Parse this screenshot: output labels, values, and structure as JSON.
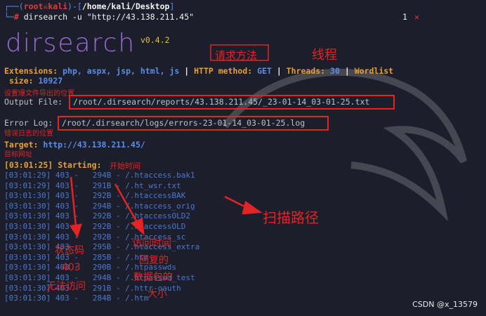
{
  "prompt": {
    "user": "root",
    "host": "kali",
    "path": "/home/kali/Desktop",
    "command": "dirsearch -u \"http://43.138.211.45\"",
    "tab_number": "1",
    "close_glyph": "✕"
  },
  "banner": {
    "logo_text": "dirsearch",
    "version": "v0.4.2"
  },
  "config": {
    "extensions_label": "Extensions:",
    "extensions_value": "php, aspx, jsp, html, js",
    "http_method_label": "HTTP method:",
    "http_method_value": "GET",
    "threads_label": "Threads:",
    "threads_value": "30",
    "wordlist_label": "Wordlist",
    "wordlist_size_label": "size:",
    "wordlist_size_value": "10927",
    "separator": "|"
  },
  "output_file": {
    "label": "Output File:",
    "path": "/root/.dirsearch/reports/43.138.211.45/_23-01-14_03-01-25.txt"
  },
  "error_log": {
    "label": "Error Log:",
    "path": "/root/.dirsearch/logs/errors-23-01-14_03-01-25.log"
  },
  "target": {
    "label": "Target:",
    "url": "http://43.138.211.45/"
  },
  "starting": {
    "time": "[03:01:25]",
    "label": "Starting:"
  },
  "results": [
    {
      "time": "[03:01:29]",
      "status": "403",
      "size": "294B",
      "path": "/.htaccess.bak1"
    },
    {
      "time": "[03:01:29]",
      "status": "403",
      "size": "291B",
      "path": "/.ht_wsr.txt"
    },
    {
      "time": "[03:01:30]",
      "status": "403",
      "size": "292B",
      "path": "/.htaccessBAK"
    },
    {
      "time": "[03:01:30]",
      "status": "403",
      "size": "294B",
      "path": "/.htaccess_orig"
    },
    {
      "time": "[03:01:30]",
      "status": "403",
      "size": "292B",
      "path": "/.htaccessOLD2"
    },
    {
      "time": "[03:01:30]",
      "status": "403",
      "size": "292B",
      "path": "/.htaccessOLD"
    },
    {
      "time": "[03:01:30]",
      "status": "403",
      "size": "292B",
      "path": "/.htaccess_sc"
    },
    {
      "time": "[03:01:30]",
      "status": "403",
      "size": "295B",
      "path": "/.htaccess_extra"
    },
    {
      "time": "[03:01:30]",
      "status": "403",
      "size": "285B",
      "path": "/.htm"
    },
    {
      "time": "[03:01:30]",
      "status": "403",
      "size": "290B",
      "path": "/.htpasswds"
    },
    {
      "time": "[03:01:30]",
      "status": "403",
      "size": "294B",
      "path": "/.htpasswd_test"
    },
    {
      "time": "[03:01:30]",
      "status": "403",
      "size": "291B",
      "path": "/.httr-oauth"
    },
    {
      "time": "[03:01:30]",
      "status": "403",
      "size": "284B",
      "path": "/.htm"
    }
  ],
  "annotations": {
    "request_method": "请求方法",
    "threads": "线程",
    "output_file_note": "设置爆文件导出的位置",
    "error_log_note": "错误日志的位置",
    "target_note": "目标网址",
    "start_time": "开始时间",
    "scan_path": "扫描路径",
    "status_code": "状态码",
    "status_403": "403",
    "no_access": "无法访问",
    "access_time": "访问时间",
    "response_size_1": "回复的",
    "response_size_2": "数据包的",
    "response_size_3": "大小"
  },
  "watermark": "CSDN @x_13579",
  "colors": {
    "background": "#1c1e2b",
    "accent_red": "#e22424",
    "prompt_blue": "#5a8de8",
    "config_orange": "#e8a030",
    "log_blue": "#4a78d2"
  }
}
